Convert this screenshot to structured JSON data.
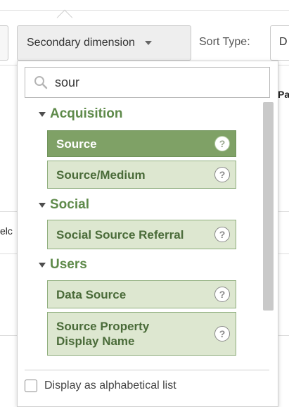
{
  "toolbar": {
    "secondary_dimension_label": "Secondary dimension",
    "sort_type_label": "Sort Type:",
    "sort_type_value": "D"
  },
  "background": {
    "right_header_fragment": "Pa",
    "left_row_fragment": "elc"
  },
  "dropdown": {
    "search_value": "sour",
    "search_placeholder": "",
    "groups": [
      {
        "title": "Acquisition",
        "items": [
          {
            "label": "Source",
            "selected": true
          },
          {
            "label": "Source/Medium",
            "selected": false
          }
        ]
      },
      {
        "title": "Social",
        "items": [
          {
            "label": "Social Source Referral",
            "selected": false
          }
        ]
      },
      {
        "title": "Users",
        "items": [
          {
            "label": "Data Source",
            "selected": false
          },
          {
            "label": "Source Property Display Name",
            "selected": false
          }
        ]
      }
    ],
    "help_glyph": "?",
    "alphabetical_label": "Display as alphabetical list",
    "alphabetical_checked": false
  },
  "colors": {
    "group_title": "#5e8a4a",
    "item_bg": "#dde7d0",
    "item_selected_bg": "#7fa166",
    "item_border": "#8fae7d"
  },
  "icons": {
    "search": "search-icon",
    "help": "help-circle-icon",
    "expand": "caret-down-icon"
  }
}
